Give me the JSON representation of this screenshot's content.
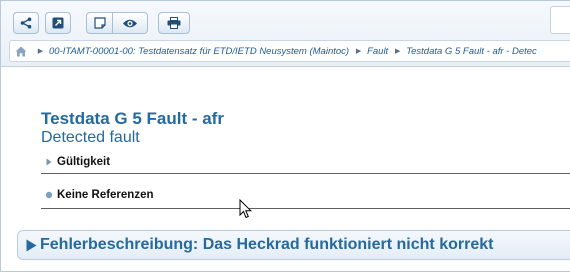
{
  "toolbar": {
    "buttons": [
      {
        "name": "share",
        "icon": "share-icon"
      },
      {
        "name": "open",
        "icon": "open-external-icon"
      },
      {
        "name": "note",
        "icon": "note-icon"
      },
      {
        "name": "view",
        "icon": "eye-icon"
      },
      {
        "name": "print",
        "icon": "printer-icon"
      }
    ]
  },
  "breadcrumb": {
    "home_icon": "home-icon",
    "items": [
      "00-ITAMT-00001-00: Testdatensatz für ETD/IETD Neusystem (Maintoc)",
      "Fault",
      "Testdata G 5 Fault - afr - Detec"
    ]
  },
  "document": {
    "title": "Testdata G 5 Fault - afr",
    "subtitle": "Detected fault",
    "rows": [
      {
        "label": "Gültigkeit",
        "marker": "triangle-right-icon"
      },
      {
        "label": "Keine Referenzen",
        "marker": "bullet-icon"
      }
    ],
    "section": {
      "label": "Fehlerbeschreibung: Das Heckrad funktioniert nicht korrekt",
      "icon": "triangle-right-icon"
    }
  },
  "colors": {
    "accent": "#246a9e",
    "link": "#1f5d93",
    "toolbar_icon": "#1d4f7a"
  }
}
